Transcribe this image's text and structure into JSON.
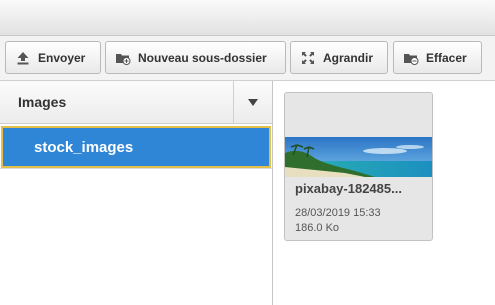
{
  "toolbar": {
    "upload": {
      "label": "Envoyer",
      "icon": "upload-icon"
    },
    "new_folder": {
      "label": "Nouveau sous-dossier",
      "icon": "folder-add-icon"
    },
    "enlarge": {
      "label": "Agrandir",
      "icon": "expand-icon"
    },
    "delete": {
      "label": "Effacer",
      "icon": "folder-delete-icon"
    }
  },
  "sidebar": {
    "title": "Images",
    "toggle_icon": "triangle-down-icon",
    "folders": [
      {
        "name": "stock_images",
        "selected": true
      }
    ]
  },
  "files": [
    {
      "name": "pixabay-182485...",
      "date": "28/03/2019 15:33",
      "size": "186.0 Ko"
    }
  ],
  "colors": {
    "selection": "#2f86d6",
    "selection_border": "#e2c04a"
  }
}
